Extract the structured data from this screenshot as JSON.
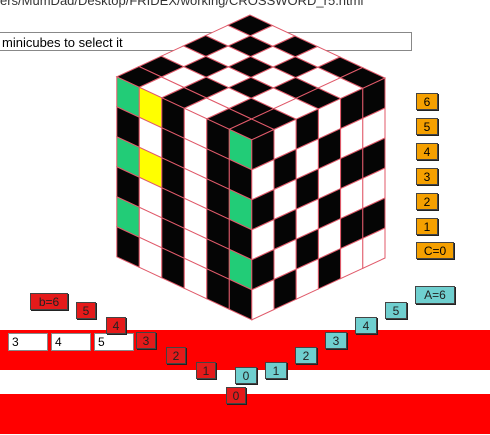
{
  "path": "ers/MumDad/Desktop/FRIDEX/working/CROSSWORD_r5.html",
  "hint": "minicubes to select it",
  "c_buttons": [
    "6",
    "5",
    "4",
    "3",
    "2",
    "1",
    "C=0"
  ],
  "b_buttons": [
    "b=6",
    "5",
    "4",
    "3",
    "2",
    "1"
  ],
  "a_buttons": [
    "A=6",
    "5",
    "4",
    "3",
    "2",
    "1"
  ],
  "zero_a": "0",
  "zero_b": "0",
  "inputs": [
    "3",
    "4",
    "5"
  ],
  "colors": {
    "orange": "#f5a000",
    "red": "#e51a1a",
    "teal": "#6fcfcf",
    "green": "#22cc77",
    "yellow": "#ffff00",
    "band": "#ff0000"
  },
  "top_face": [
    "BWBWB",
    "WBWBW",
    "BWBWB",
    "WBWBW",
    "BWBWB"
  ],
  "left_face": [
    "GYBWB",
    "BWBWB",
    "GYBWB",
    "BWBWB",
    "GWBWB",
    "BWBWB"
  ],
  "right_face": [
    "BWBWB",
    "WBWBW",
    "BWBWB",
    "WBWBW",
    "BWBWB",
    "WBWBW"
  ]
}
